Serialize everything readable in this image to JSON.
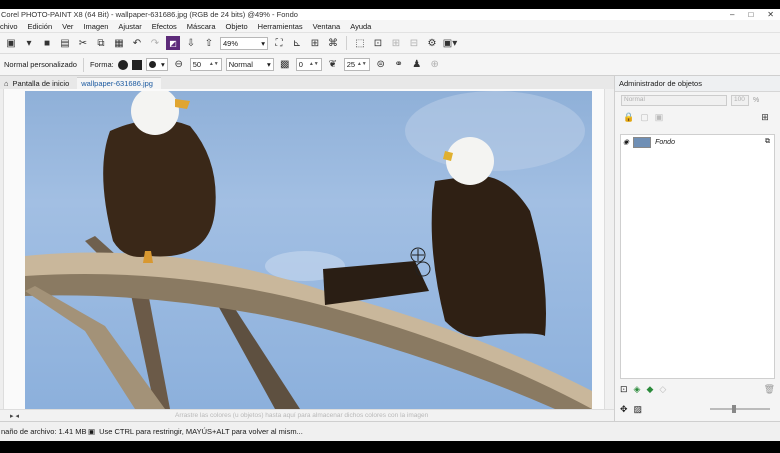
{
  "window": {
    "title": "Corel PHOTO-PAINT X8 (64 Bit) - wallpaper-631686.jpg (RGB de 24 bits) @49% - Fondo",
    "controls": [
      "–",
      "□",
      "✕"
    ]
  },
  "menu": [
    "chivo",
    "Edición",
    "Ver",
    "Imagen",
    "Ajustar",
    "Efectos",
    "Máscara",
    "Objeto",
    "Herramientas",
    "Ventana",
    "Ayuda"
  ],
  "toolbar": {
    "zoom": "49%"
  },
  "property_bar": {
    "brush_type": "Normal personalizado",
    "forma_label": "Forma:",
    "size_value": "50",
    "merge_mode": "Normal",
    "transparency_value": "0",
    "feather_value": "25"
  },
  "tabs": {
    "home": "Pantalla de inicio",
    "document": "wallpaper-631686.jpg"
  },
  "hint": {
    "text": "Arrastre las colores (u objetos) hasta aquí para almacenar dichos colores con la imagen"
  },
  "object_manager": {
    "title": "Administrador de objetos",
    "merge_mode": "Normal",
    "opacity": "100",
    "opacity_unit": "%",
    "layers": [
      {
        "name": "Fondo"
      }
    ]
  },
  "status": {
    "file_size": "naño de archivo: 1.41 MB",
    "message": "Use CTRL para restringir, MAYÚS+ALT para volver al mism..."
  }
}
